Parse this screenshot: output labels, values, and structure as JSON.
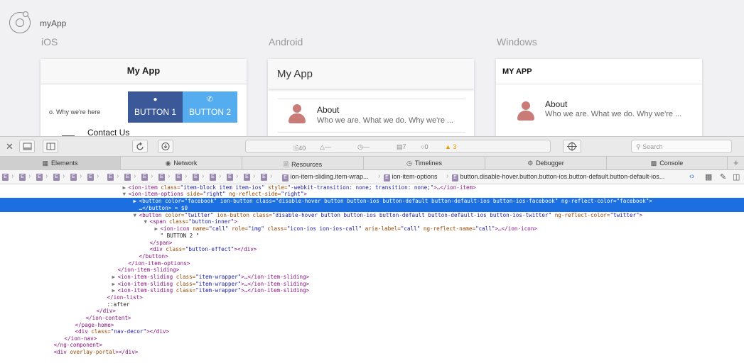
{
  "preview": {
    "app_name": "myApp",
    "platforms": [
      "iOS",
      "Android",
      "Windows"
    ],
    "ios": {
      "title": "My App",
      "row_text": "o. Why we're here",
      "button1": "BUTTON 1",
      "button2": "BUTTON 2",
      "contact": "Contact Us"
    },
    "android": {
      "title": "My App",
      "item_title": "About",
      "item_sub": "Who we are. What we do. Why we're ..."
    },
    "windows": {
      "title": "MY APP",
      "item_title": "About",
      "item_sub": "Who we are. What we do. Why we're ..."
    }
  },
  "toolbar": {
    "activity": {
      "resources": "40",
      "requests": "—",
      "load_time": "—",
      "logs": "7",
      "errors": "0",
      "warnings": "3"
    },
    "search_placeholder": "Search"
  },
  "tabs": [
    "Elements",
    "Network",
    "Resources",
    "Timelines",
    "Debugger",
    "Console"
  ],
  "breadcrumb": {
    "element_badge": "E",
    "item1": "ion-item-sliding.item-wrap...",
    "item2": "ion-item-options",
    "item3": "button.disable-hover.button.button-ios.button-default.button-default-ios..."
  },
  "dom_lines": [
    {
      "indent": 23,
      "tw": "▶",
      "sel": false,
      "parts": [
        [
          "tg",
          "<ion-item "
        ],
        [
          "an",
          "class="
        ],
        [
          "av",
          "\"item-block item item-ios\" "
        ],
        [
          "an",
          "style="
        ],
        [
          "av",
          "\"-webkit-transition: none; transition: none;\""
        ],
        [
          "tg",
          ">…</ion-item>"
        ]
      ]
    },
    {
      "indent": 23,
      "tw": "▼",
      "sel": false,
      "parts": [
        [
          "tg",
          "<ion-item-options "
        ],
        [
          "an",
          "side="
        ],
        [
          "av",
          "\"right\" "
        ],
        [
          "an",
          "ng-reflect-side="
        ],
        [
          "av",
          "\"right\""
        ],
        [
          "tg",
          ">"
        ]
      ]
    },
    {
      "indent": 25,
      "tw": "▶",
      "sel": true,
      "parts": [
        [
          "tg",
          "<button "
        ],
        [
          "an",
          "color="
        ],
        [
          "av",
          "\"facebook\" "
        ],
        [
          "an",
          "ion-button "
        ],
        [
          "an",
          "class="
        ],
        [
          "av",
          "\"disable-hover button button-ios button-default button-default-ios button-ios-facebook\" "
        ],
        [
          "an",
          "ng-reflect-color="
        ],
        [
          "av",
          "\"facebook\""
        ],
        [
          "tg",
          ">"
        ]
      ]
    },
    {
      "indent": 25,
      "tw": "",
      "sel": true,
      "parts": [
        [
          "tg",
          "…</button>"
        ],
        [
          "tx",
          " = $0"
        ]
      ]
    },
    {
      "indent": 25,
      "tw": "▼",
      "sel": false,
      "parts": [
        [
          "tg",
          "<button "
        ],
        [
          "an",
          "color="
        ],
        [
          "av",
          "\"twitter\" "
        ],
        [
          "an",
          "ion-button "
        ],
        [
          "an",
          "class="
        ],
        [
          "av",
          "\"disable-hover button button-ios button-default button-default-ios button-ios-twitter\" "
        ],
        [
          "an",
          "ng-reflect-color="
        ],
        [
          "av",
          "\"twitter\""
        ],
        [
          "tg",
          ">"
        ]
      ]
    },
    {
      "indent": 27,
      "tw": "▼",
      "sel": false,
      "parts": [
        [
          "tg",
          "<span "
        ],
        [
          "an",
          "class="
        ],
        [
          "av",
          "\"button-inner\""
        ],
        [
          "tg",
          ">"
        ]
      ]
    },
    {
      "indent": 29,
      "tw": "▶",
      "sel": false,
      "parts": [
        [
          "tg",
          "<ion-icon "
        ],
        [
          "an",
          "name="
        ],
        [
          "av",
          "\"call\" "
        ],
        [
          "an",
          "role="
        ],
        [
          "av",
          "\"img\" "
        ],
        [
          "an",
          "class="
        ],
        [
          "av",
          "\"icon-ios ion-ios-call\" "
        ],
        [
          "an",
          "aria-label="
        ],
        [
          "av",
          "\"call\" "
        ],
        [
          "an",
          "ng-reflect-name="
        ],
        [
          "av",
          "\"call\""
        ],
        [
          "tg",
          ">…</ion-icon>"
        ]
      ]
    },
    {
      "indent": 29,
      "tw": "",
      "sel": false,
      "parts": [
        [
          "tx",
          "\" BUTTON 2 \""
        ]
      ]
    },
    {
      "indent": 27,
      "tw": "",
      "sel": false,
      "parts": [
        [
          "tg",
          "</span>"
        ]
      ]
    },
    {
      "indent": 27,
      "tw": "",
      "sel": false,
      "parts": [
        [
          "tg",
          "<div "
        ],
        [
          "an",
          "class="
        ],
        [
          "av",
          "\"button-effect\""
        ],
        [
          "tg",
          "></div>"
        ]
      ]
    },
    {
      "indent": 25,
      "tw": "",
      "sel": false,
      "parts": [
        [
          "tg",
          "</button>"
        ]
      ]
    },
    {
      "indent": 23,
      "tw": "",
      "sel": false,
      "parts": [
        [
          "tg",
          "</ion-item-options>"
        ]
      ]
    },
    {
      "indent": 21,
      "tw": "",
      "sel": false,
      "parts": [
        [
          "tg",
          "</ion-item-sliding>"
        ]
      ]
    },
    {
      "indent": 21,
      "tw": "▶",
      "sel": false,
      "parts": [
        [
          "tg",
          "<ion-item-sliding "
        ],
        [
          "an",
          "class="
        ],
        [
          "av",
          "\"item-wrapper\""
        ],
        [
          "tg",
          ">…</ion-item-sliding>"
        ]
      ]
    },
    {
      "indent": 21,
      "tw": "▶",
      "sel": false,
      "parts": [
        [
          "tg",
          "<ion-item-sliding "
        ],
        [
          "an",
          "class="
        ],
        [
          "av",
          "\"item-wrapper\""
        ],
        [
          "tg",
          ">…</ion-item-sliding>"
        ]
      ]
    },
    {
      "indent": 21,
      "tw": "▶",
      "sel": false,
      "parts": [
        [
          "tg",
          "<ion-item-sliding "
        ],
        [
          "an",
          "class="
        ],
        [
          "av",
          "\"item-wrapper\""
        ],
        [
          "tg",
          ">…</ion-item-sliding>"
        ]
      ]
    },
    {
      "indent": 19,
      "tw": "",
      "sel": false,
      "parts": [
        [
          "tg",
          "</ion-list>"
        ]
      ]
    },
    {
      "indent": 19,
      "tw": "",
      "sel": false,
      "parts": [
        [
          "tx",
          "::after"
        ]
      ]
    },
    {
      "indent": 17,
      "tw": "",
      "sel": false,
      "parts": [
        [
          "tg",
          "</div>"
        ]
      ]
    },
    {
      "indent": 15,
      "tw": "",
      "sel": false,
      "parts": [
        [
          "tg",
          "</ion-content>"
        ]
      ]
    },
    {
      "indent": 13,
      "tw": "",
      "sel": false,
      "parts": [
        [
          "tg",
          "</page-home>"
        ]
      ]
    },
    {
      "indent": 13,
      "tw": "",
      "sel": false,
      "parts": [
        [
          "tg",
          "<div "
        ],
        [
          "an",
          "class="
        ],
        [
          "av",
          "\"nav-decor\""
        ],
        [
          "tg",
          "></div>"
        ]
      ]
    },
    {
      "indent": 11,
      "tw": "",
      "sel": false,
      "parts": [
        [
          "tg",
          "</ion-nav>"
        ]
      ]
    },
    {
      "indent": 9,
      "tw": "",
      "sel": false,
      "parts": [
        [
          "tg",
          "</ng-component>"
        ]
      ]
    },
    {
      "indent": 9,
      "tw": "",
      "sel": false,
      "parts": [
        [
          "tg",
          "<div "
        ],
        [
          "an",
          "overlay-portal"
        ],
        [
          "tg",
          "></div>"
        ]
      ]
    }
  ]
}
